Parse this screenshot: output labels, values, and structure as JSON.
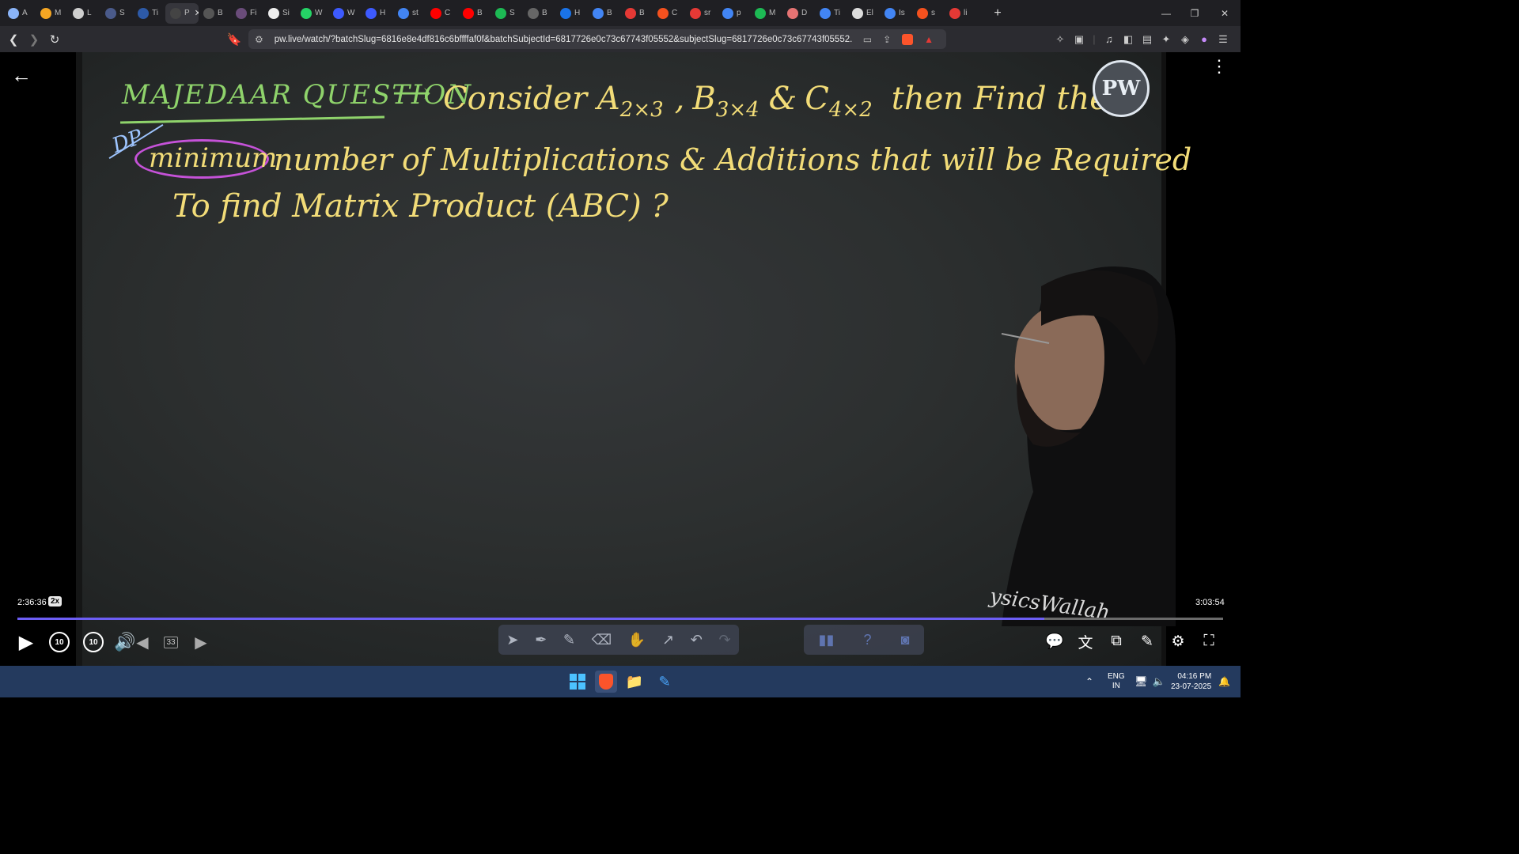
{
  "browser": {
    "tabs": [
      {
        "label": "A",
        "color": "#8ab4f8"
      },
      {
        "label": "M",
        "color": "#f5a623"
      },
      {
        "label": "L",
        "color": "#cfcfcf"
      },
      {
        "label": "S",
        "color": "#4a5a8a"
      },
      {
        "label": "Ti",
        "color": "#2d5aa8"
      },
      {
        "label": "P",
        "color": "#444",
        "active": true
      },
      {
        "label": "B",
        "color": "#555"
      },
      {
        "label": "Fi",
        "color": "#6a4c7a"
      },
      {
        "label": "Si",
        "color": "#eee"
      },
      {
        "label": "W",
        "color": "#25d366"
      },
      {
        "label": "W",
        "color": "#3d5afe"
      },
      {
        "label": "H",
        "color": "#3d5afe"
      },
      {
        "label": "st",
        "color": "#4285f4"
      },
      {
        "label": "C",
        "color": "#ff0000"
      },
      {
        "label": "B",
        "color": "#ff0000"
      },
      {
        "label": "S",
        "color": "#1db954"
      },
      {
        "label": "B",
        "color": "#666"
      },
      {
        "label": "H",
        "color": "#1a73e8"
      },
      {
        "label": "B",
        "color": "#4285f4"
      },
      {
        "label": "B",
        "color": "#e53935"
      },
      {
        "label": "C",
        "color": "#f4511e"
      },
      {
        "label": "sr",
        "color": "#e53935"
      },
      {
        "label": "p",
        "color": "#4285f4"
      },
      {
        "label": "M",
        "color": "#1db954"
      },
      {
        "label": "D",
        "color": "#e57373"
      },
      {
        "label": "Ti",
        "color": "#4285f4"
      },
      {
        "label": "El",
        "color": "#ddd"
      },
      {
        "label": "Is",
        "color": "#4285f4"
      },
      {
        "label": "s",
        "color": "#f4511e"
      },
      {
        "label": "li",
        "color": "#e53935"
      }
    ],
    "new_tab_label": "+",
    "url": "pw.live/watch/?batchSlug=6816e8e4df816c6bffffaf0f&batchSubjectId=6817726e0c73c67743f05552&subjectSlug=6817726e0c73c67743f05552..."
  },
  "board": {
    "heading": "MAJEDAAR QUESTION",
    "arrow": "⟶",
    "line1": "Consider A",
    "sub_a": "2×3",
    "comma": ",",
    "b": "B",
    "sub_b": "3×4",
    "amp": "&",
    "c": "C",
    "sub_c": "4×2",
    "line1_end": "then Find the",
    "annotation": "DP",
    "circled": "minimum",
    "line2": "number of Multiplications & Additions that will be Required",
    "line3": "To find Matrix Product (ABC) ?",
    "logo": "PW",
    "watermark": "ysicsWallah"
  },
  "player": {
    "current_time": "2:36:36",
    "speed": "2x",
    "duration": "3:03:54",
    "progress": 0.8517,
    "skip_back": "10",
    "skip_forward": "10",
    "slide_counter": "33"
  },
  "taskbar": {
    "lang_top": "ENG",
    "lang_bottom": "IN",
    "time": "04:16 PM",
    "date": "23-07-2025"
  }
}
